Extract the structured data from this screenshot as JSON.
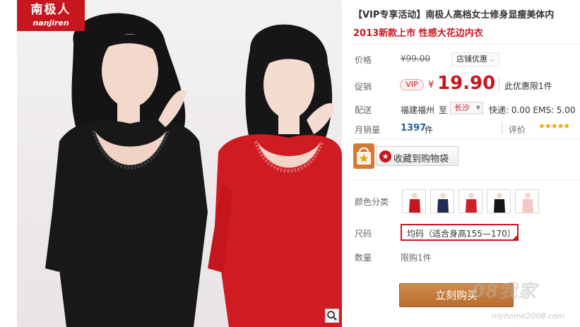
{
  "brand": {
    "name_cn": "南极人",
    "name_en": "nanjiren"
  },
  "product": {
    "title": "【VIP专享活动】南极人高档女士修身显瘦美体内",
    "subtitle": "2013新款上市 性感大花边内衣"
  },
  "price": {
    "label": "价格",
    "original": "¥99.00",
    "shop_discount": "店铺优惠",
    "promo_label": "促销",
    "vip_badge": "VIP",
    "currency": "¥",
    "promo_price": "19.90",
    "limit_text": "此优惠限1件"
  },
  "delivery": {
    "label": "配送",
    "origin": "福建福州",
    "to_word": "至",
    "destination": "长沙",
    "shipping": "快递: 0.00 EMS: 5.00"
  },
  "sales": {
    "label": "月销量",
    "count": "1397",
    "unit": "件",
    "rating_label": "评价",
    "stars": "★★★★★",
    "rating": 5
  },
  "favorite": {
    "label": "收藏到购物袋"
  },
  "options": {
    "color_label": "颜色分类",
    "swatches": [
      {
        "name": "red",
        "color": "#c8161e"
      },
      {
        "name": "navy",
        "color": "#1f2b55"
      },
      {
        "name": "red",
        "color": "#d0202a"
      },
      {
        "name": "black",
        "color": "#161616"
      },
      {
        "name": "pink",
        "color": "#f2c9c4"
      }
    ],
    "size_label": "尺码",
    "size_value": "均码（适合身高155—170）",
    "qty_label": "数量",
    "qty_value": "限购1件"
  },
  "actions": {
    "buy_now": "立刻购买"
  },
  "watermark": {
    "text": "08我家",
    "url": "myhome2008.com"
  },
  "colors": {
    "accent_red": "#c8161e",
    "buy_orange": "#c27a3c",
    "link_blue": "#1f5f9c"
  }
}
